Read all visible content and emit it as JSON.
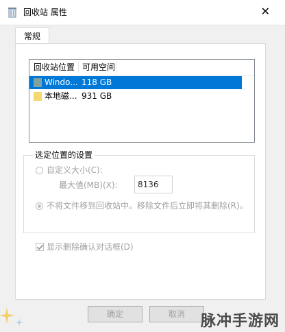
{
  "window": {
    "title": "回收站 属性",
    "close_glyph": "✕"
  },
  "tabs": [
    {
      "label": "常规"
    }
  ],
  "list": {
    "columns": [
      "回收站位置",
      "可用空间"
    ],
    "rows": [
      {
        "location": "Windo...",
        "space": "118 GB",
        "selected": true,
        "icon_color": "#7fa3a3"
      },
      {
        "location": "本地磁...",
        "space": "931 GB",
        "selected": false,
        "icon_color": "#f5d970"
      }
    ]
  },
  "settings": {
    "group_title": "选定位置的设置",
    "custom_size_label": "自定义大小(C):",
    "max_size_label": "最大值(MB)(X):",
    "max_size_value": "8136",
    "no_move_label": "不将文件移到回收站中。移除文件后立即将其删除(R)。"
  },
  "confirm": {
    "label": "显示删除确认对话框(D)",
    "checked": true
  },
  "buttons": {
    "ok": "确定",
    "cancel": "取消"
  },
  "watermark": "脉冲手游网"
}
